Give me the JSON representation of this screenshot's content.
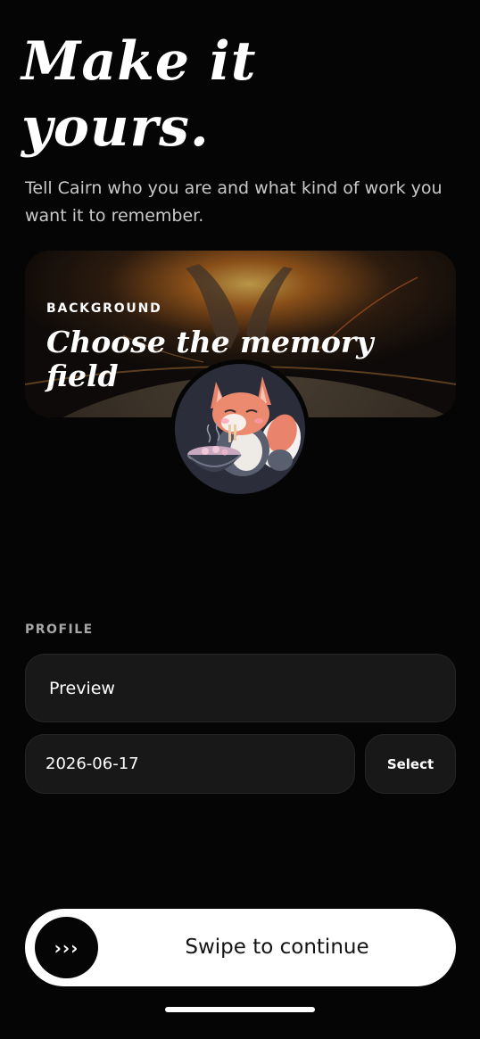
{
  "header": {
    "title": "Make it yours.",
    "subtitle": "Tell Cairn who you are and what kind of work you want it to remember."
  },
  "background_card": {
    "label": "BACKGROUND",
    "title": "Choose the memory field"
  },
  "avatar": {
    "icon": "fox-eating-noodles-icon"
  },
  "profile": {
    "section_label": "PROFILE",
    "name_value": "Preview",
    "date_value": "2026-06-17",
    "select_label": "Select"
  },
  "swipe": {
    "knob_glyph": "›››",
    "label": "Swipe to continue"
  },
  "colors": {
    "background": "#050505",
    "field": "#181818",
    "swipe_bg": "#ffffff",
    "accent_glow": "#f0a030"
  }
}
